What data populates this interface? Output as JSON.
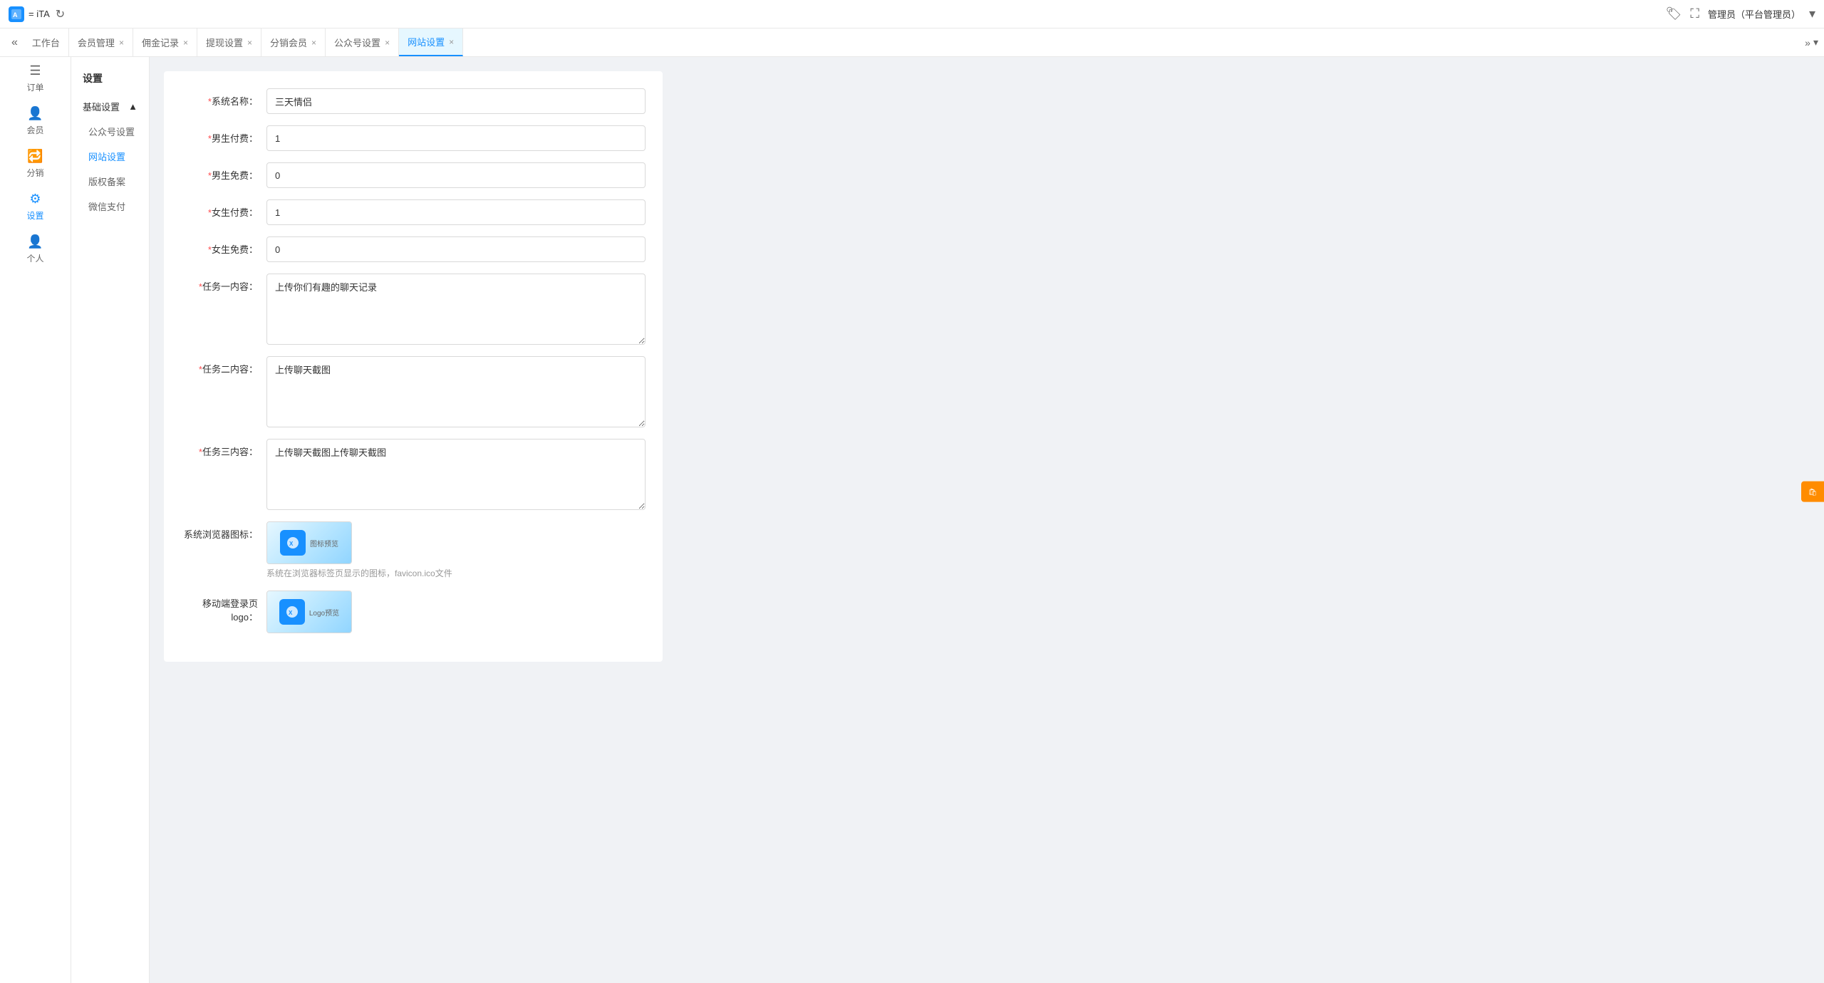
{
  "topbar": {
    "logo_text": "= iTA",
    "refresh_icon": "↻",
    "label_icon": "🏷",
    "fullscreen_icon": "⛶",
    "user_text": "管理员（平台管理员）",
    "dropdown_icon": "▾"
  },
  "tabs": [
    {
      "id": "collapse",
      "label": "«",
      "closable": false
    },
    {
      "id": "workbench",
      "label": "工作台",
      "closable": false
    },
    {
      "id": "member-mgmt",
      "label": "会员管理",
      "closable": true
    },
    {
      "id": "commission",
      "label": "佣金记录",
      "closable": true
    },
    {
      "id": "withdraw",
      "label": "提现设置",
      "closable": true
    },
    {
      "id": "distribute",
      "label": "分销会员",
      "closable": true
    },
    {
      "id": "wechat-settings",
      "label": "公众号设置",
      "closable": true
    },
    {
      "id": "website-settings",
      "label": "网站设置",
      "closable": true,
      "active": true
    }
  ],
  "tab_more_icon": "»",
  "tab_expand_icon": "▾",
  "sidebar": {
    "items": [
      {
        "id": "order",
        "icon": "☰",
        "label": "订单"
      },
      {
        "id": "member",
        "icon": "👤",
        "label": "会员"
      },
      {
        "id": "distribute",
        "icon": "🔁",
        "label": "分销"
      },
      {
        "id": "settings",
        "icon": "⚙",
        "label": "设置",
        "active": true
      },
      {
        "id": "personal",
        "icon": "👤",
        "label": "个人"
      }
    ]
  },
  "sub_sidebar": {
    "title": "设置",
    "sections": [
      {
        "id": "basic",
        "label": "基础设置",
        "expanded": true,
        "items": [
          {
            "id": "wechat-settings",
            "label": "公众号设置"
          },
          {
            "id": "website-settings",
            "label": "网站设置",
            "active": true
          },
          {
            "id": "copyright",
            "label": "版权备案"
          },
          {
            "id": "wechat-pay",
            "label": "微信支付"
          }
        ]
      }
    ]
  },
  "form": {
    "fields": [
      {
        "id": "system-name",
        "label": "*系统名称：",
        "required": true,
        "type": "input",
        "value": "三天情侣"
      },
      {
        "id": "male-pay",
        "label": "*男生付费：",
        "required": true,
        "type": "input",
        "value": "1"
      },
      {
        "id": "male-free",
        "label": "*男生免费：",
        "required": true,
        "type": "input",
        "value": "0"
      },
      {
        "id": "female-pay",
        "label": "*女生付费：",
        "required": true,
        "type": "input",
        "value": "1"
      },
      {
        "id": "female-free",
        "label": "*女生免费：",
        "required": true,
        "type": "input",
        "value": "0"
      },
      {
        "id": "task1",
        "label": "*任务一内容：",
        "required": true,
        "type": "textarea",
        "value": "上传你们有趣的聊天记录"
      },
      {
        "id": "task2",
        "label": "*任务二内容：",
        "required": true,
        "type": "textarea",
        "value": "上传聊天截图"
      },
      {
        "id": "task3",
        "label": "*任务三内容：",
        "required": true,
        "type": "textarea",
        "value": "上传聊天截图上传聊天截图"
      },
      {
        "id": "browser-icon",
        "label": "系统浏览器图标：",
        "required": false,
        "type": "upload",
        "hint": "系统在浏览器标签页显示的图标，favicon.ico文件"
      },
      {
        "id": "mobile-logo",
        "label": "移动端登录页logo：",
        "required": false,
        "type": "upload",
        "hint": ""
      }
    ]
  },
  "right_float": {
    "icon": "🛍",
    "label": ""
  }
}
